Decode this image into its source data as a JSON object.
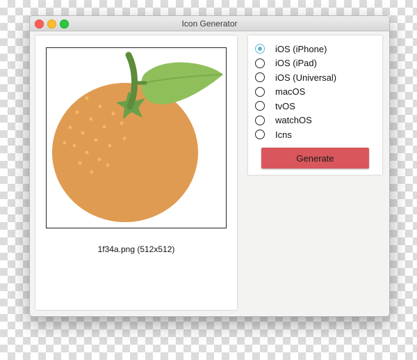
{
  "window": {
    "title": "Icon Generator"
  },
  "preview": {
    "caption": "1f34a.png (512x512)"
  },
  "platforms": {
    "options": [
      {
        "label": "iOS (iPhone)",
        "checked": true
      },
      {
        "label": "iOS (iPad)",
        "checked": false
      },
      {
        "label": "iOS (Universal)",
        "checked": false
      },
      {
        "label": "macOS",
        "checked": false
      },
      {
        "label": "tvOS",
        "checked": false
      },
      {
        "label": "watchOS",
        "checked": false
      },
      {
        "label": "Icns",
        "checked": false
      }
    ]
  },
  "actions": {
    "generate_label": "Generate"
  },
  "colors": {
    "accent_radio": "#5bb7d0",
    "generate_button": "#d9575c",
    "orange_fruit": "#e09b52",
    "leaf": "#8fbf5a",
    "stem": "#5d8c3b"
  }
}
